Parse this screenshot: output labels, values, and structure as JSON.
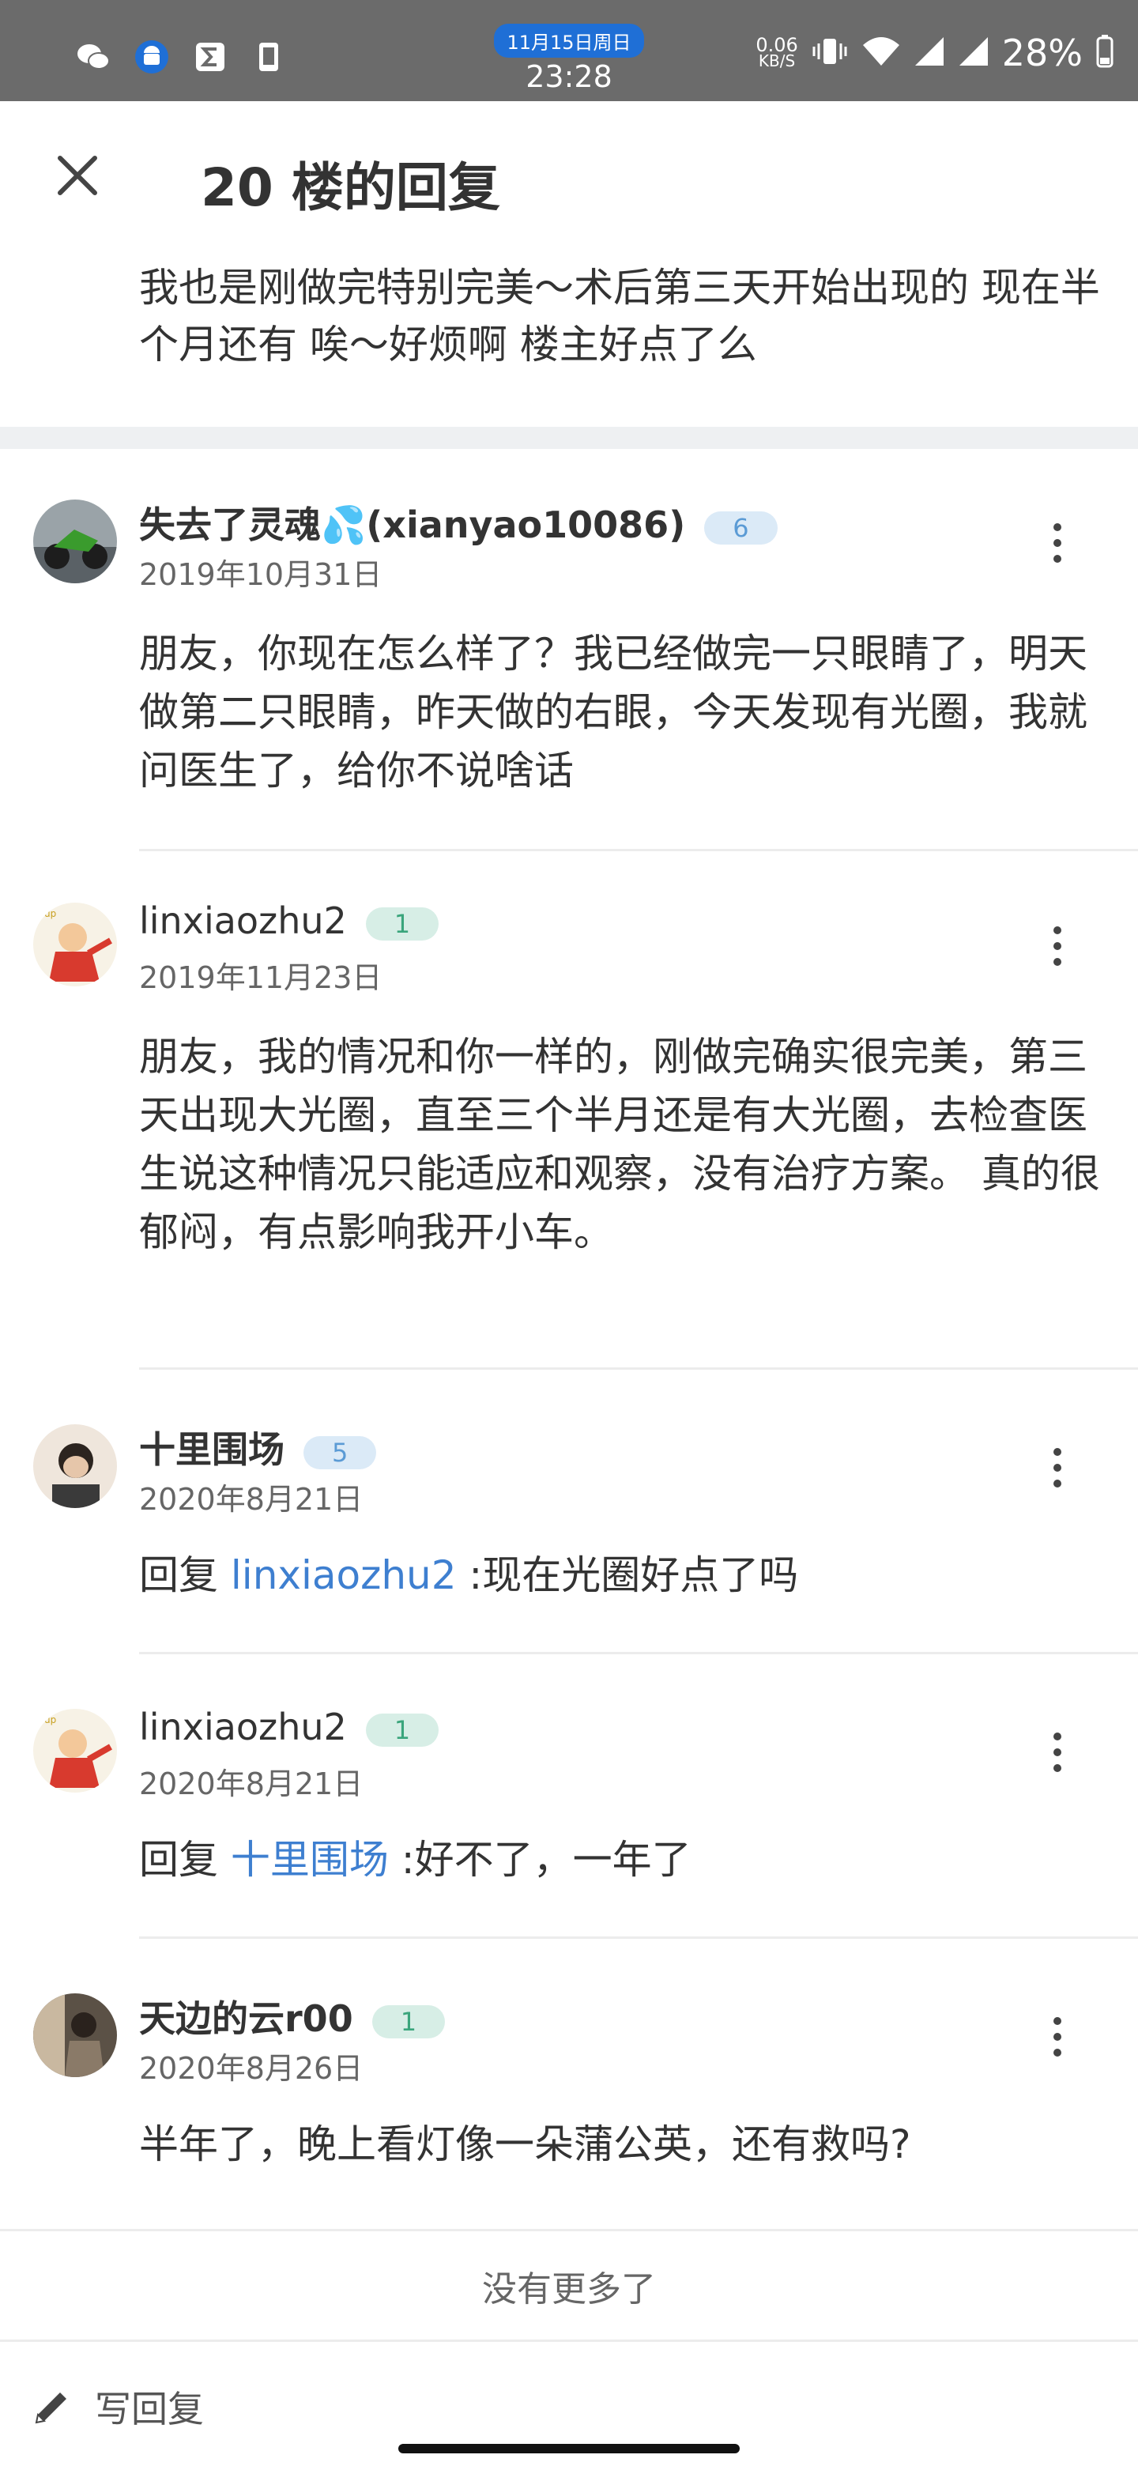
{
  "status_bar": {
    "date": "11月15日周日",
    "time": "23:28",
    "net_speed": "0.06",
    "net_unit": "KB/S",
    "battery": "28%",
    "left_icons": [
      "wechat-icon",
      "android-icon",
      "sigma-icon",
      "phone-icon"
    ],
    "right_icons": [
      "vibrate-icon",
      "wifi-icon",
      "signal-icon",
      "signal-icon",
      "battery-icon"
    ]
  },
  "header": {
    "title": "20 楼的回复",
    "original_post": "我也是刚做完特别完美～术后第三天开始出现的 现在半个月还有 唉～好烦啊 楼主好点了么"
  },
  "replies": [
    {
      "user": "失去了灵魂💦(xianyao10086)",
      "level": "6",
      "date": "2019年10月31日",
      "text": "朋友，你现在怎么样了？我已经做完一只眼睛了，明天做第二只眼睛，昨天做的右眼，今天发现有光圈，我就问医生了，给你不说啥话"
    },
    {
      "user": "linxiaozhu2",
      "level": "1",
      "date": "2019年11月23日",
      "text": "朋友，我的情况和你一样的，刚做完确实很完美，第三天出现大光圈，直至三个半月还是有大光圈，去检查医生说这种情况只能适应和观察，没有治疗方案。 真的很郁闷，有点影响我开小车。"
    },
    {
      "user": "十里围场",
      "level": "5",
      "date": "2020年8月21日",
      "reply_prefix": "回复 ",
      "reply_to": "linxiaozhu2",
      "text": " :现在光圈好点了吗"
    },
    {
      "user": "linxiaozhu2",
      "level": "1",
      "date": "2020年8月21日",
      "reply_prefix": "回复 ",
      "reply_to": "十里围场",
      "text": " :好不了，一年了"
    },
    {
      "user": "天边的云r00",
      "level": "1",
      "date": "2020年8月26日",
      "text": "半年了，晚上看灯像一朵蒲公英，还有救吗?"
    }
  ],
  "footer": {
    "no_more": "没有更多了",
    "write_reply": "写回复"
  },
  "colors": {
    "status_bar_bg": "#6b6b6b",
    "link": "#3e7fd0",
    "badge_blue_bg": "#dbeaf7",
    "badge_teal_bg": "#d7eee6"
  }
}
